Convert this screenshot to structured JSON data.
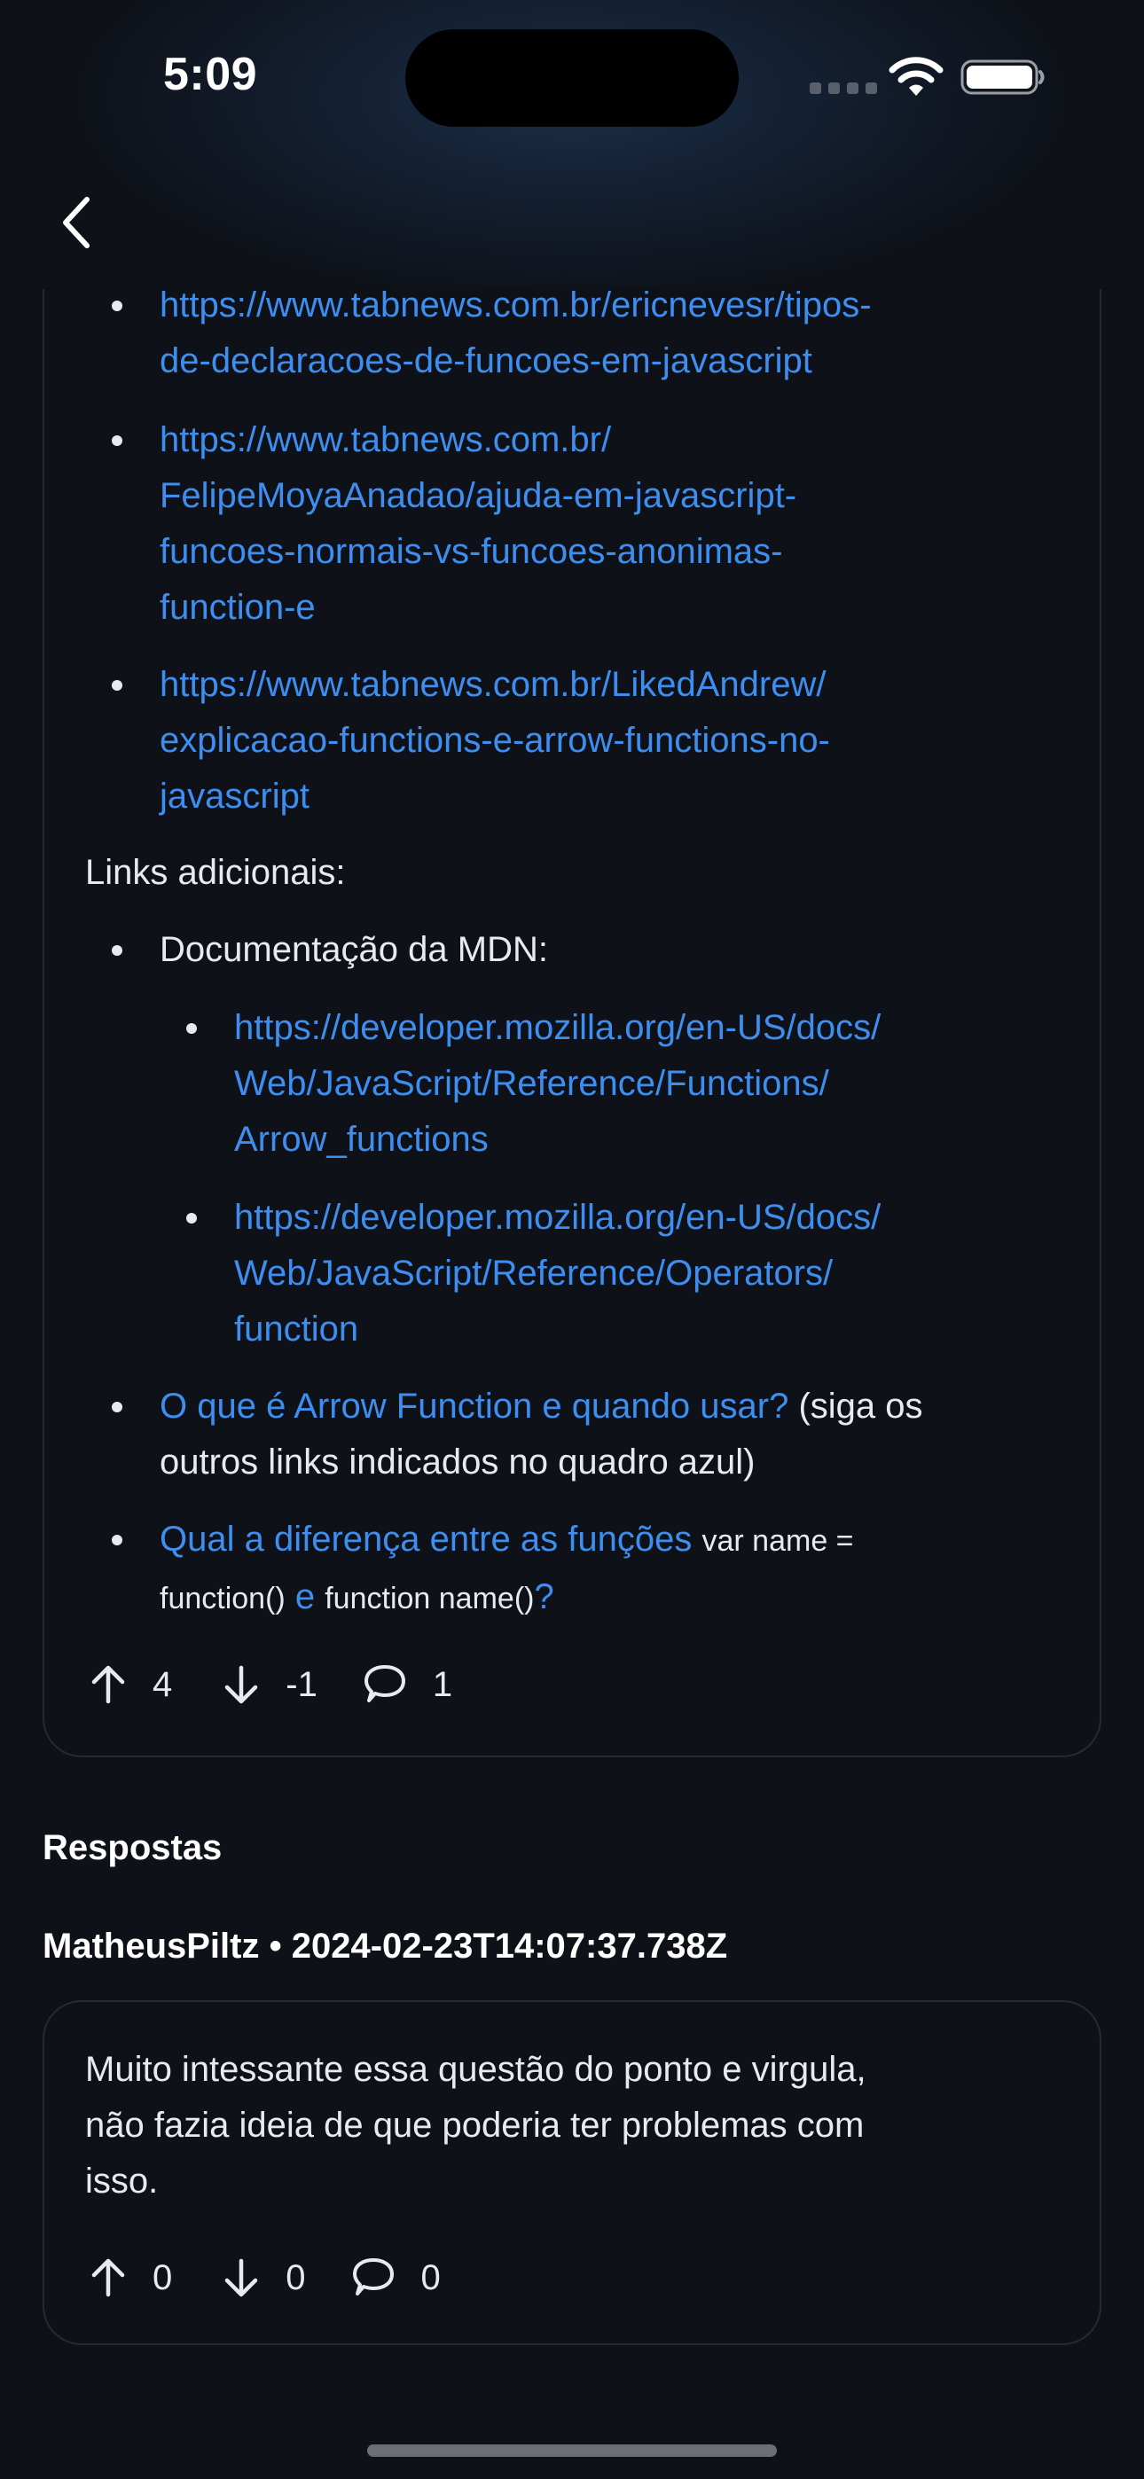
{
  "status_bar": {
    "time": "5:09"
  },
  "post": {
    "link_list_1": [
      {
        "lines": [
          "https://www.tabnews.com.br/ericnevesr/tipos-",
          "de-declaracoes-de-funcoes-em-javascript"
        ]
      },
      {
        "lines": [
          "https://www.tabnews.com.br/",
          "FelipeMoyaAnadao/ajuda-em-javascript-",
          "funcoes-normais-vs-funcoes-anonimas-",
          "function-e"
        ]
      },
      {
        "lines": [
          "https://www.tabnews.com.br/LikedAndrew/",
          "explicacao-functions-e-arrow-functions-no-",
          "javascript"
        ]
      }
    ],
    "additional_links_label": "Links adicionais:",
    "mdn_label": "Documentação da MDN:",
    "mdn_links": [
      {
        "lines": [
          "https://developer.mozilla.org/en-US/docs/",
          "Web/JavaScript/Reference/Functions/",
          "Arrow_functions"
        ]
      },
      {
        "lines": [
          "https://developer.mozilla.org/en-US/docs/",
          "Web/JavaScript/Reference/Operators/",
          "function"
        ]
      }
    ],
    "arrow_item": {
      "link": "O que é Arrow Function e quando usar?",
      "text_1": " (siga os",
      "text_2": "outros links indicados no quadro azul)"
    },
    "diff_item": {
      "link_1": "Qual a diferença entre as funções",
      "code_1a": "var name =",
      "code_1b": "function()",
      "link_2": "e",
      "code_2": "function name()",
      "link_3": "?"
    },
    "actions": {
      "upvotes": "4",
      "downvotes": "-1",
      "comments": "1"
    }
  },
  "replies": {
    "title": "Respostas",
    "items": [
      {
        "meta": "MatheusPiltz • 2024-02-23T14:07:37.738Z",
        "body": [
          "Muito intessante essa questão do ponto e virgula,",
          "não fazia ideia de que poderia ter problemas com",
          "isso."
        ],
        "actions": {
          "upvotes": "0",
          "downvotes": "0",
          "comments": "0"
        }
      }
    ]
  }
}
